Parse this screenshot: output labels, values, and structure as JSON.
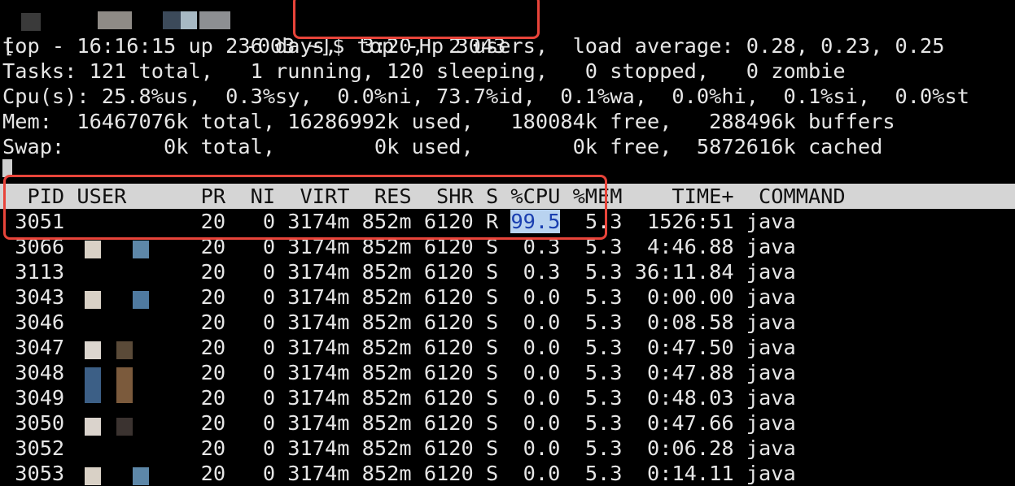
{
  "terminal": {
    "prompt_prefix": "[",
    "prompt_host_suffix": " -003 ~]$ ",
    "command": "top -Hp 3043",
    "summary": [
      "top - 16:16:15 up 236 days,  3:20,  2 users,  load average: 0.28, 0.23, 0.25",
      "Tasks: 121 total,   1 running, 120 sleeping,   0 stopped,   0 zombie",
      "Cpu(s): 25.8%us,  0.3%sy,  0.0%ni, 73.7%id,  0.1%wa,  0.0%hi,  0.1%si,  0.0%st",
      "Mem:  16467076k total, 16286992k used,   180084k free,   288496k buffers",
      "Swap:        0k total,        0k used,        0k free,  5872616k cached"
    ],
    "table_header": "  PID USER      PR  NI  VIRT  RES  SHR S %CPU %MEM    TIME+  COMMAND",
    "rows": [
      {
        "pid": "3051",
        "pr": "20",
        "ni": "0",
        "virt": "3174m",
        "res": "852m",
        "shr": "6120",
        "s": "R",
        "cpu": "99.5",
        "mem": "5.3",
        "time": "1526:51",
        "cmd": "java"
      },
      {
        "pid": "3066",
        "pr": "20",
        "ni": "0",
        "virt": "3174m",
        "res": "852m",
        "shr": "6120",
        "s": "S",
        "cpu": "0.3",
        "mem": "5.3",
        "time": "4:46.88",
        "cmd": "java"
      },
      {
        "pid": "3113",
        "pr": "20",
        "ni": "0",
        "virt": "3174m",
        "res": "852m",
        "shr": "6120",
        "s": "S",
        "cpu": "0.3",
        "mem": "5.3",
        "time": "36:11.84",
        "cmd": "java"
      },
      {
        "pid": "3043",
        "pr": "20",
        "ni": "0",
        "virt": "3174m",
        "res": "852m",
        "shr": "6120",
        "s": "S",
        "cpu": "0.0",
        "mem": "5.3",
        "time": "0:00.00",
        "cmd": "java"
      },
      {
        "pid": "3046",
        "pr": "20",
        "ni": "0",
        "virt": "3174m",
        "res": "852m",
        "shr": "6120",
        "s": "S",
        "cpu": "0.0",
        "mem": "5.3",
        "time": "0:08.58",
        "cmd": "java"
      },
      {
        "pid": "3047",
        "pr": "20",
        "ni": "0",
        "virt": "3174m",
        "res": "852m",
        "shr": "6120",
        "s": "S",
        "cpu": "0.0",
        "mem": "5.3",
        "time": "0:47.50",
        "cmd": "java"
      },
      {
        "pid": "3048",
        "pr": "20",
        "ni": "0",
        "virt": "3174m",
        "res": "852m",
        "shr": "6120",
        "s": "S",
        "cpu": "0.0",
        "mem": "5.3",
        "time": "0:47.88",
        "cmd": "java"
      },
      {
        "pid": "3049",
        "pr": "20",
        "ni": "0",
        "virt": "3174m",
        "res": "852m",
        "shr": "6120",
        "s": "S",
        "cpu": "0.0",
        "mem": "5.3",
        "time": "0:48.03",
        "cmd": "java"
      },
      {
        "pid": "3050",
        "pr": "20",
        "ni": "0",
        "virt": "3174m",
        "res": "852m",
        "shr": "6120",
        "s": "S",
        "cpu": "0.0",
        "mem": "5.3",
        "time": "0:47.66",
        "cmd": "java"
      },
      {
        "pid": "3052",
        "pr": "20",
        "ni": "0",
        "virt": "3174m",
        "res": "852m",
        "shr": "6120",
        "s": "S",
        "cpu": "0.0",
        "mem": "5.3",
        "time": "0:06.28",
        "cmd": "java"
      },
      {
        "pid": "3053",
        "pr": "20",
        "ni": "0",
        "virt": "3174m",
        "res": "852m",
        "shr": "6120",
        "s": "S",
        "cpu": "0.0",
        "mem": "5.3",
        "time": "0:14.11",
        "cmd": "java"
      }
    ]
  },
  "colors": {
    "background": "#000000",
    "text": "#e6e6e6",
    "header_bar": "#d5d5d5",
    "annotation": "#e8443a",
    "selection": "#b9d3f0"
  }
}
